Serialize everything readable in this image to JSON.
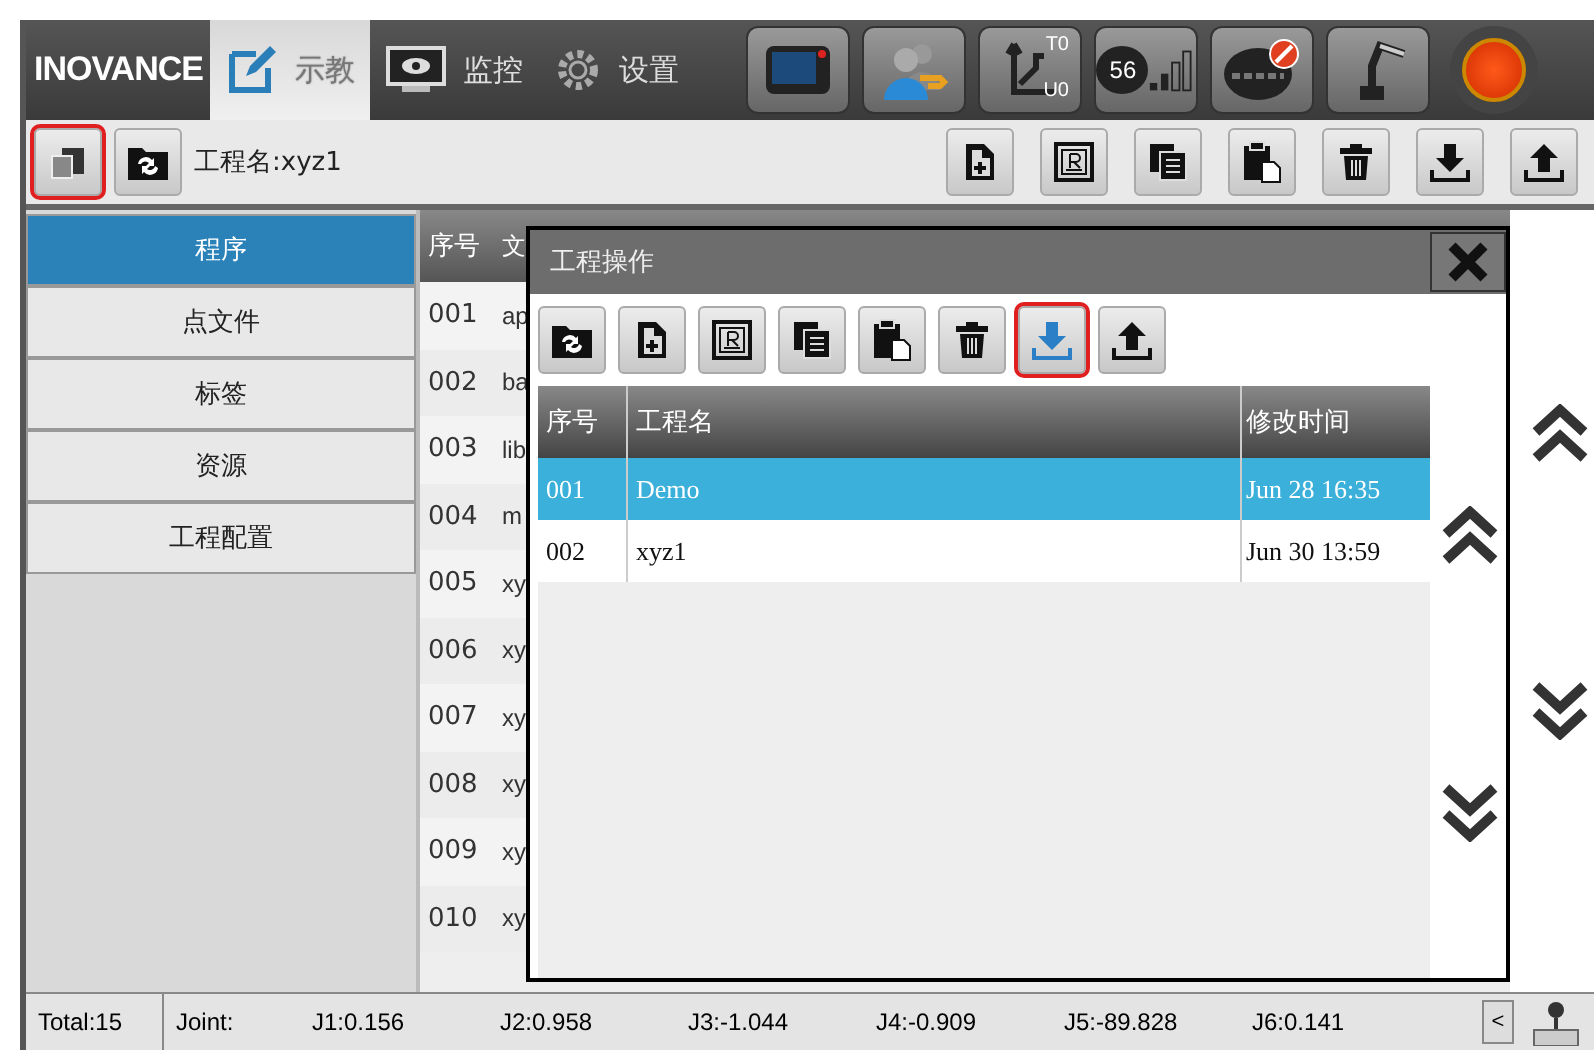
{
  "header": {
    "logo": "INOVANCE",
    "tabs": [
      {
        "label": "示教",
        "selected": true
      },
      {
        "label": "监控",
        "selected": false
      },
      {
        "label": "设置",
        "selected": false
      }
    ],
    "coord_badge": {
      "top": "T0",
      "bottom": "U0"
    },
    "signal": "56"
  },
  "toolbar": {
    "left_buttons": [
      {
        "selected": true
      },
      {
        "selected": false
      }
    ],
    "project_label": "工程名:xyz1"
  },
  "sidebar": {
    "items": [
      {
        "label": "程序",
        "selected": true
      },
      {
        "label": "点文件",
        "selected": false
      },
      {
        "label": "标签",
        "selected": false
      },
      {
        "label": "资源",
        "selected": false
      },
      {
        "label": "工程配置",
        "selected": false
      }
    ]
  },
  "table": {
    "columns": [
      "序号",
      "文"
    ],
    "rows": [
      {
        "no": "001",
        "name": "ap"
      },
      {
        "no": "002",
        "name": "ba"
      },
      {
        "no": "003",
        "name": "lib"
      },
      {
        "no": "004",
        "name": "m"
      },
      {
        "no": "005",
        "name": "xy"
      },
      {
        "no": "006",
        "name": "xy"
      },
      {
        "no": "007",
        "name": "xy"
      },
      {
        "no": "008",
        "name": "xy"
      },
      {
        "no": "009",
        "name": "xy"
      },
      {
        "no": "010",
        "name": "xy"
      }
    ]
  },
  "dialog": {
    "title": "工程操作",
    "tools": [
      {
        "selected": false
      },
      {
        "selected": false
      },
      {
        "selected": false
      },
      {
        "selected": false
      },
      {
        "selected": false
      },
      {
        "selected": false
      },
      {
        "selected": true
      },
      {
        "selected": false
      }
    ],
    "columns": [
      "序号",
      "工程名",
      "修改时间"
    ],
    "rows": [
      {
        "no": "001",
        "name": "Demo",
        "time": "Jun 28 16:35",
        "selected": true
      },
      {
        "no": "002",
        "name": "xyz1",
        "time": "Jun 30 13:59",
        "selected": false
      }
    ]
  },
  "status_bar": {
    "total": "Total:15",
    "joint_label": "Joint:",
    "joints": [
      "J1:0.156",
      "J2:0.958",
      "J3:-1.044",
      "J4:-0.909",
      "J5:-89.828",
      "J6:0.141"
    ],
    "scroll_button": "<"
  }
}
